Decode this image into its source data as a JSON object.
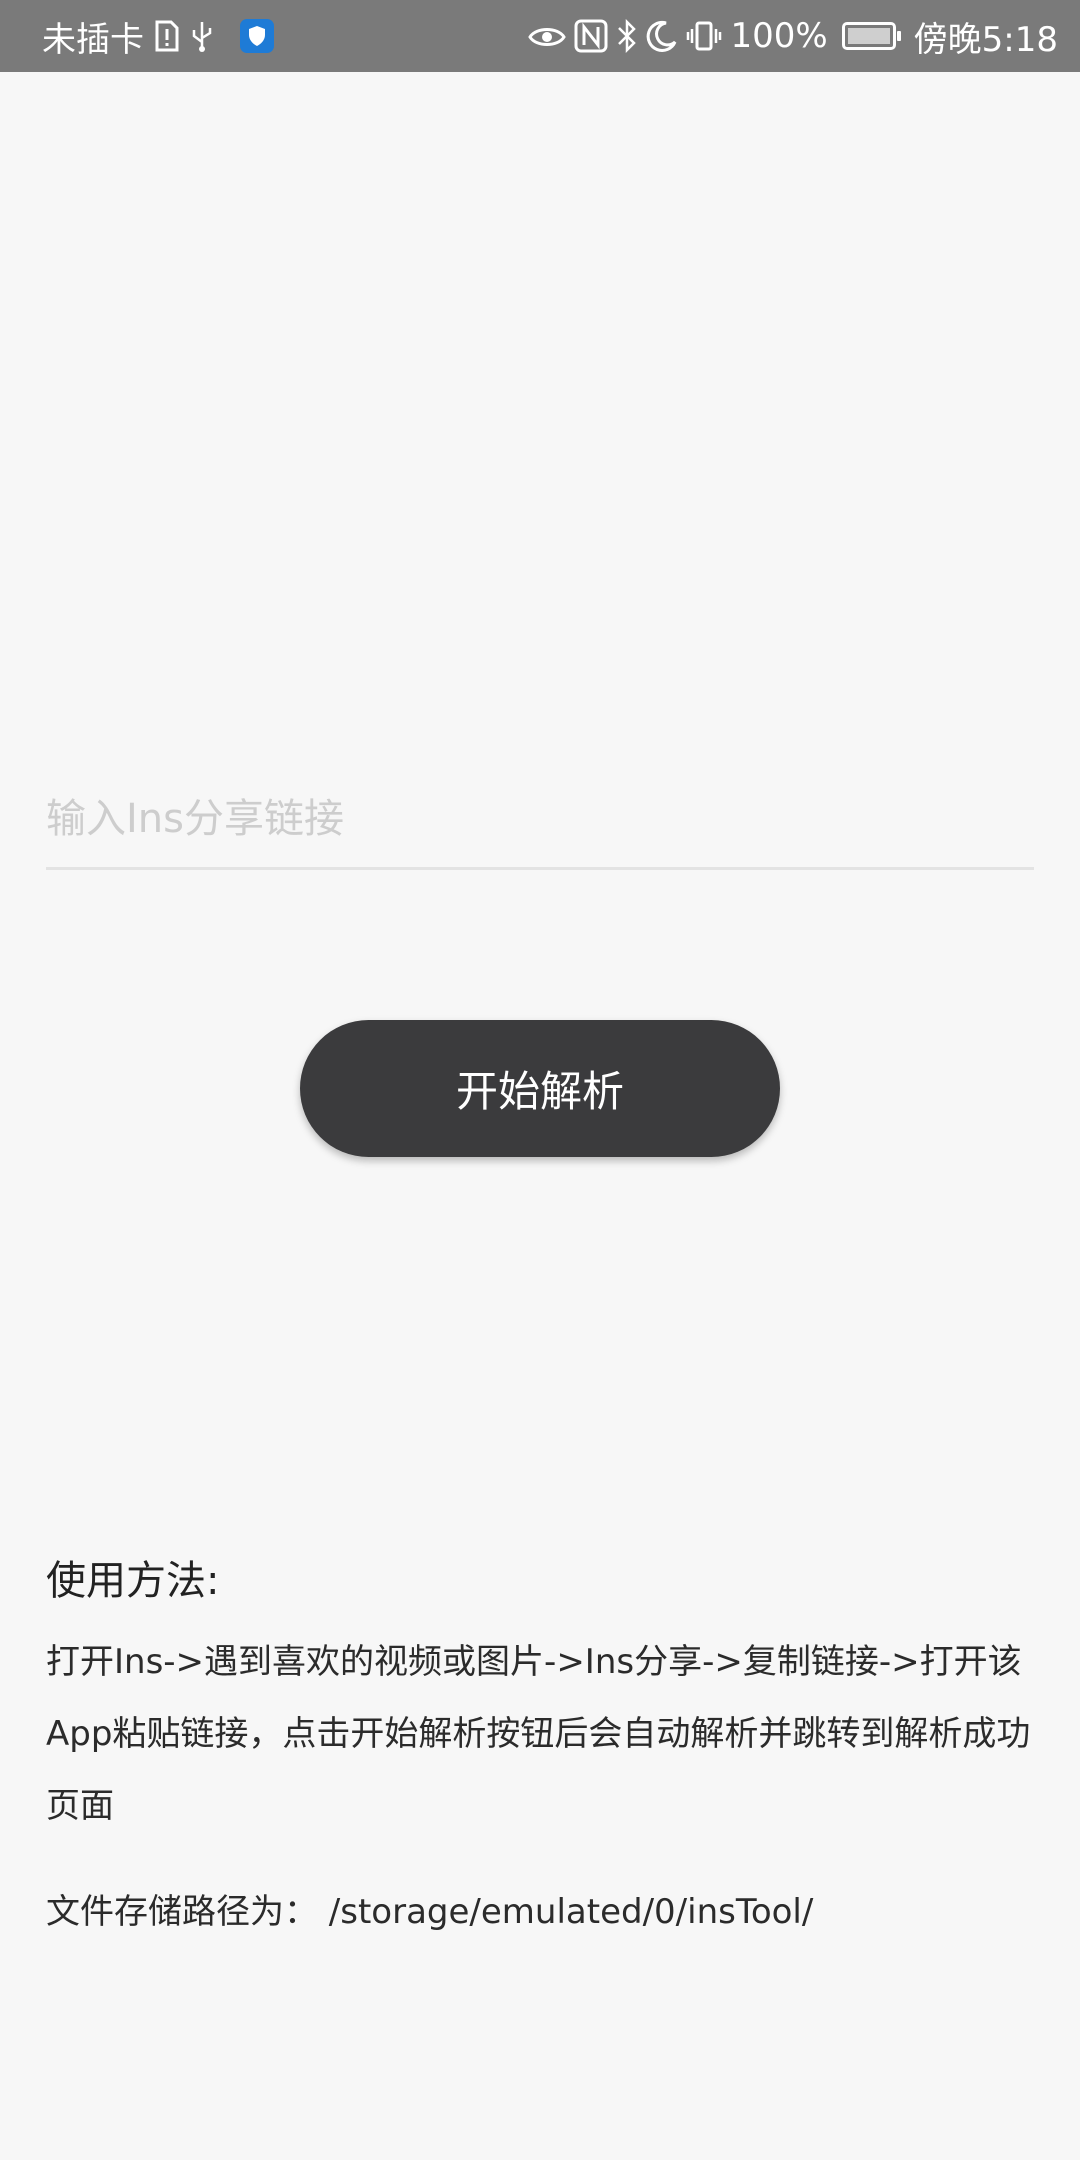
{
  "status_bar": {
    "carrier": "未插卡",
    "battery_level": "100%",
    "time": "傍晚5:18",
    "icons": [
      "sim-alert-icon",
      "usb-icon",
      "shield-app-icon",
      "eye-comfort-icon",
      "nfc-icon",
      "bluetooth-icon",
      "do-not-disturb-icon",
      "vibrate-icon",
      "battery-charging-icon"
    ]
  },
  "input": {
    "placeholder": "输入Ins分享链接",
    "value": ""
  },
  "parse_button": {
    "label": "开始解析"
  },
  "usage": {
    "title": "使用方法:",
    "body": "打开Ins->遇到喜欢的视频或图片->Ins分享->复制链接->打开该App粘贴链接，点击开始解析按钮后会自动解析并跳转到解析成功页面",
    "storage_path": "文件存储路径为： /storage/emulated/0/insTool/"
  },
  "colors": {
    "status_bar_bg": "#7a7a7a",
    "page_bg": "#f7f7f7",
    "button_bg": "#3b3b3d",
    "shield_badge": "#1e7bd6"
  }
}
